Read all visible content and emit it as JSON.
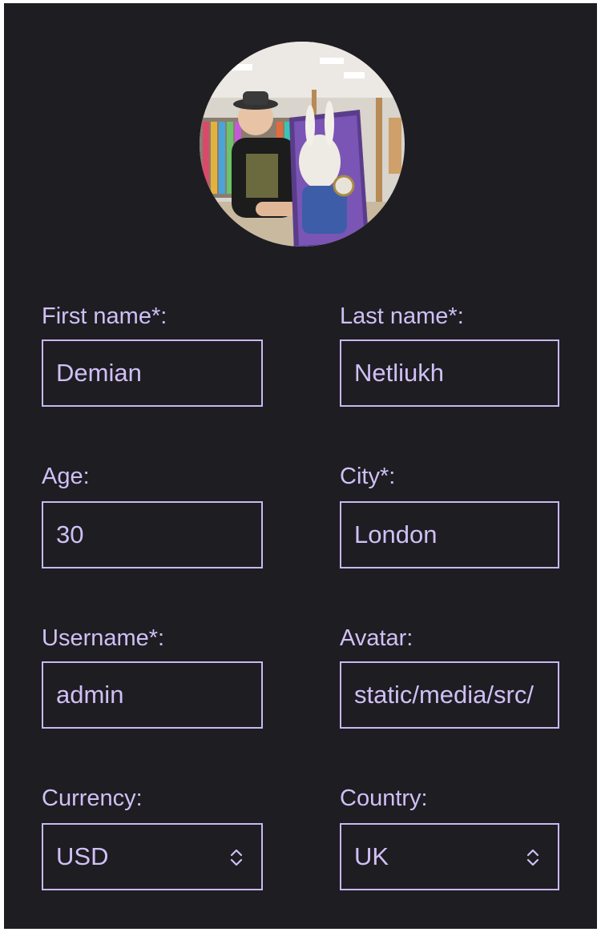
{
  "profile": {
    "avatar_icon": "user-photo"
  },
  "form": {
    "first_name": {
      "label": "First name*:",
      "value": "Demian"
    },
    "last_name": {
      "label": "Last name*:",
      "value": "Netliukh"
    },
    "age": {
      "label": "Age:",
      "value": "30"
    },
    "city": {
      "label": "City*:",
      "value": "London"
    },
    "username": {
      "label": "Username*:",
      "value": "admin"
    },
    "avatar": {
      "label": "Avatar:",
      "value": "static/media/src/"
    },
    "currency": {
      "label": "Currency:",
      "value": "USD",
      "icon": "select-arrows-icon"
    },
    "country": {
      "label": "Country:",
      "value": "UK",
      "icon": "select-arrows-icon"
    }
  },
  "colors": {
    "background": "#1e1d22",
    "accent": "#cfc0f5",
    "border": "#c9b8f2"
  }
}
